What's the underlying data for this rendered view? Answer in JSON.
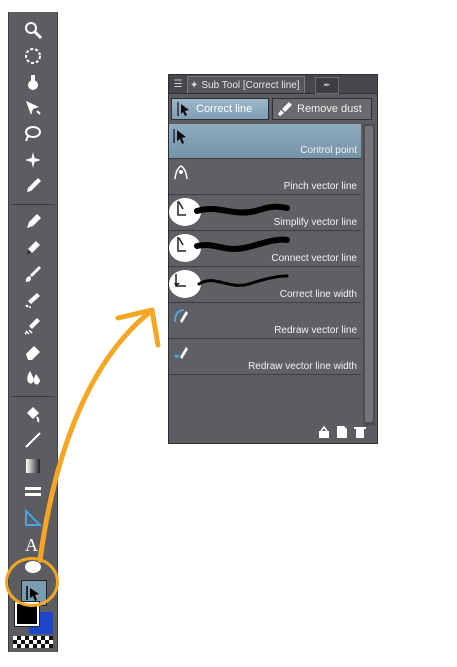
{
  "panel": {
    "tab_menu_icon": "menu-icon",
    "tab_title": "Sub Tool [Correct line]",
    "tab_other_icon": "pen-nib-icon",
    "groups": [
      {
        "label": "Correct line",
        "icon": "cursor-arrow-icon",
        "active": true
      },
      {
        "label": "Remove dust",
        "icon": "brush-icon",
        "active": false
      }
    ],
    "items": [
      {
        "label": "Control point",
        "icon": "control-point-icon",
        "selected": true
      },
      {
        "label": "Pinch vector line",
        "icon": "pinch-icon",
        "selected": false
      },
      {
        "label": "Simplify vector line",
        "icon": "simplify-icon",
        "selected": false
      },
      {
        "label": "Connect vector line",
        "icon": "connect-icon",
        "selected": false
      },
      {
        "label": "Correct line width",
        "icon": "line-width-icon",
        "selected": false
      },
      {
        "label": "Redraw vector line",
        "icon": "redraw-icon",
        "selected": false
      },
      {
        "label": "Redraw vector line width",
        "icon": "redraw-width-icon",
        "selected": false
      }
    ],
    "footer_icons": [
      "settings-icon",
      "new-document-icon",
      "trash-icon"
    ]
  },
  "toolbar": {
    "tools": [
      "zoom-icon",
      "rotate-icon",
      "hand-icon",
      "operation-icon",
      "lasso-icon",
      "magic-wand-icon",
      "eyedropper-icon",
      "pen-icon",
      "pencil-icon",
      "brush-icon",
      "airbrush-icon",
      "decoration-icon",
      "eraser-icon",
      "blend-icon",
      "fill-icon",
      "line-icon",
      "gradient-icon",
      "frame-icon",
      "ruler-icon",
      "text-icon",
      "balloon-icon",
      "correct-line-icon"
    ],
    "main_color": "#000000",
    "sub_color": "#1f45c8",
    "accent_color": "#f5a623"
  }
}
